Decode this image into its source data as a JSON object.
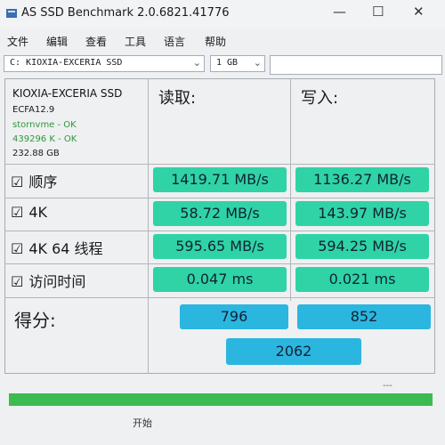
{
  "window": {
    "title": "AS SSD Benchmark 2.0.6821.41776",
    "controls": {
      "minimize": "—",
      "maximize": "☐",
      "close": "✕"
    }
  },
  "menu": [
    "文件",
    "编辑",
    "查看",
    "工具",
    "语言",
    "帮助"
  ],
  "toolbar": {
    "drive_select": "C: KIOXIA-EXCERIA SSD",
    "size_select": "1 GB"
  },
  "drive_info": {
    "name": "KIOXIA-EXCERIA SSD",
    "firmware": "ECFA12.9",
    "driver": "stornvme - OK",
    "alignment": "439296 K - OK",
    "capacity": "232.88 GB"
  },
  "columns": {
    "read": "读取:",
    "write": "写入:"
  },
  "rows": [
    {
      "label": "顺序",
      "checked": "☑",
      "read": "1419.71 MB/s",
      "write": "1136.27 MB/s"
    },
    {
      "label": "4K",
      "checked": "☑",
      "read": "58.72 MB/s",
      "write": "143.97 MB/s"
    },
    {
      "label": "4K 64 线程",
      "checked": "☑",
      "read": "595.65 MB/s",
      "write": "594.25 MB/s"
    },
    {
      "label": "访问时间",
      "checked": "☑",
      "read": "0.047 ms",
      "write": "0.021 ms"
    }
  ],
  "score": {
    "label": "得分:",
    "read": "796",
    "write": "852",
    "total": "2062"
  },
  "progress": {
    "fraction": 1.0,
    "text": "---"
  },
  "buttons": {
    "start": "开始"
  },
  "colors": {
    "result_cell": "#2fd3a6",
    "score_cell": "#2bb6e0",
    "progress": "#3dbb52",
    "ok_text": "#2c9a3a"
  }
}
